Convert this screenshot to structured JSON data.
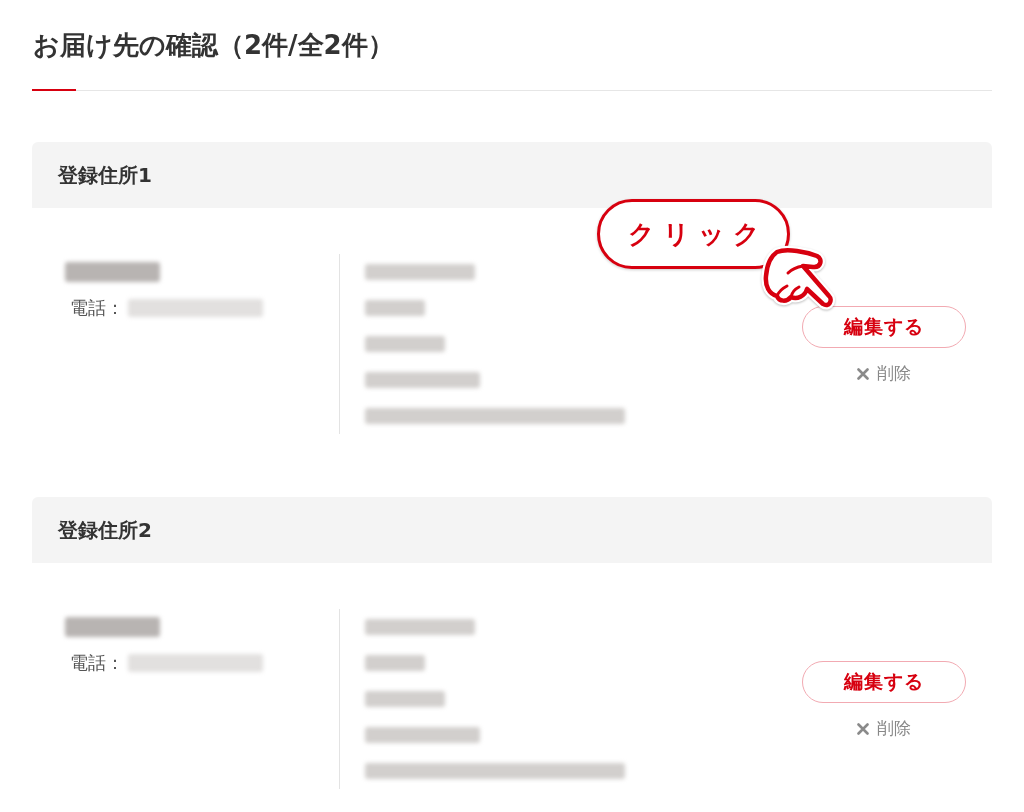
{
  "page_title": "お届け先の確認（2件/全2件）",
  "addresses": [
    {
      "heading": "登録住所1",
      "phone_label": "電話：",
      "edit_label": "編集する",
      "delete_label": "削除",
      "callout": {
        "label": "クリック"
      }
    },
    {
      "heading": "登録住所2",
      "phone_label": "電話：",
      "edit_label": "編集する",
      "delete_label": "削除"
    }
  ]
}
